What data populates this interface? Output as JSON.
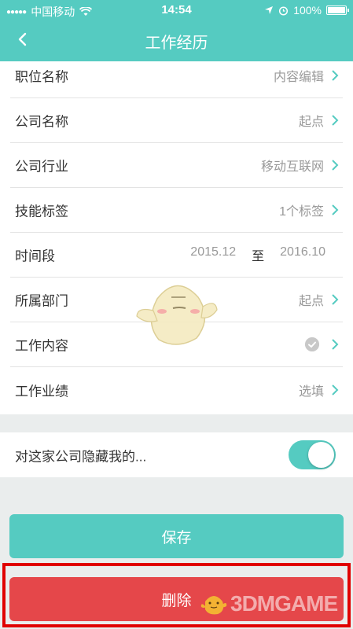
{
  "status_bar": {
    "carrier": "中国移动",
    "time": "14:54",
    "battery": "100%"
  },
  "nav": {
    "title": "工作经历"
  },
  "form": {
    "rows": [
      {
        "label": "职位名称",
        "value": "内容编辑"
      },
      {
        "label": "公司名称",
        "value": "起点"
      },
      {
        "label": "公司行业",
        "value": "移动互联网"
      },
      {
        "label": "技能标签",
        "value": "1个标签"
      },
      {
        "label": "时间段",
        "start": "2015.12",
        "to": "至",
        "end": "2016.10"
      },
      {
        "label": "所属部门",
        "value": "起点"
      },
      {
        "label": "工作内容",
        "value": ""
      },
      {
        "label": "工作业绩",
        "value": "选填"
      }
    ]
  },
  "hide_toggle": {
    "label": "对这家公司隐藏我的...",
    "on": true
  },
  "buttons": {
    "save": "保存",
    "delete": "删除"
  },
  "watermark": {
    "text": "3DMGAME"
  },
  "colors": {
    "accent": "#55cbc1",
    "danger": "#e5474a",
    "highlight": "#e00000"
  }
}
